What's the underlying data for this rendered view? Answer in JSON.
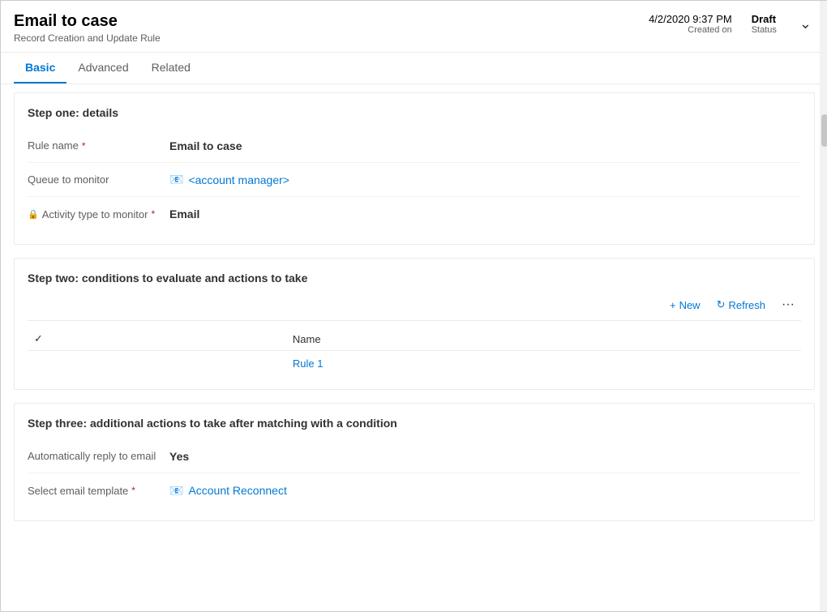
{
  "header": {
    "title": "Email to case",
    "subtitle": "Record Creation and Update Rule",
    "date_value": "4/2/2020 9:37 PM",
    "date_label": "Created on",
    "status_value": "Draft",
    "status_label": "Status"
  },
  "tabs": [
    {
      "id": "basic",
      "label": "Basic",
      "active": true
    },
    {
      "id": "advanced",
      "label": "Advanced",
      "active": false
    },
    {
      "id": "related",
      "label": "Related",
      "active": false
    }
  ],
  "step_one": {
    "title": "Step one: details",
    "fields": [
      {
        "label": "Rule name",
        "required": true,
        "lock": false,
        "value": "Email to case",
        "value_type": "bold",
        "link": false
      },
      {
        "label": "Queue to monitor",
        "required": false,
        "lock": false,
        "value": "<account manager>",
        "value_type": "link",
        "link": true,
        "link_icon": "📧"
      },
      {
        "label": "Activity type to monitor",
        "required": true,
        "lock": true,
        "value": "Email",
        "value_type": "bold",
        "link": false
      }
    ]
  },
  "step_two": {
    "title": "Step two: conditions to evaluate and actions to take",
    "toolbar": {
      "new_label": "New",
      "refresh_label": "Refresh",
      "more_label": "···"
    },
    "table": {
      "columns": [
        "Name"
      ],
      "rows": [
        {
          "name": "Rule 1"
        }
      ]
    }
  },
  "step_three": {
    "title": "Step three: additional actions to take after matching with a condition",
    "fields": [
      {
        "label": "Automatically reply to email",
        "required": false,
        "lock": false,
        "value": "Yes",
        "value_type": "bold",
        "link": false
      },
      {
        "label": "Select email template",
        "required": true,
        "lock": false,
        "value": "Account Reconnect",
        "value_type": "link",
        "link": true,
        "link_icon": "📧"
      }
    ]
  },
  "icons": {
    "plus": "+",
    "refresh": "↻",
    "chevron_down": "⌄",
    "check": "✓",
    "lock": "🔒",
    "email_link": "📧"
  }
}
